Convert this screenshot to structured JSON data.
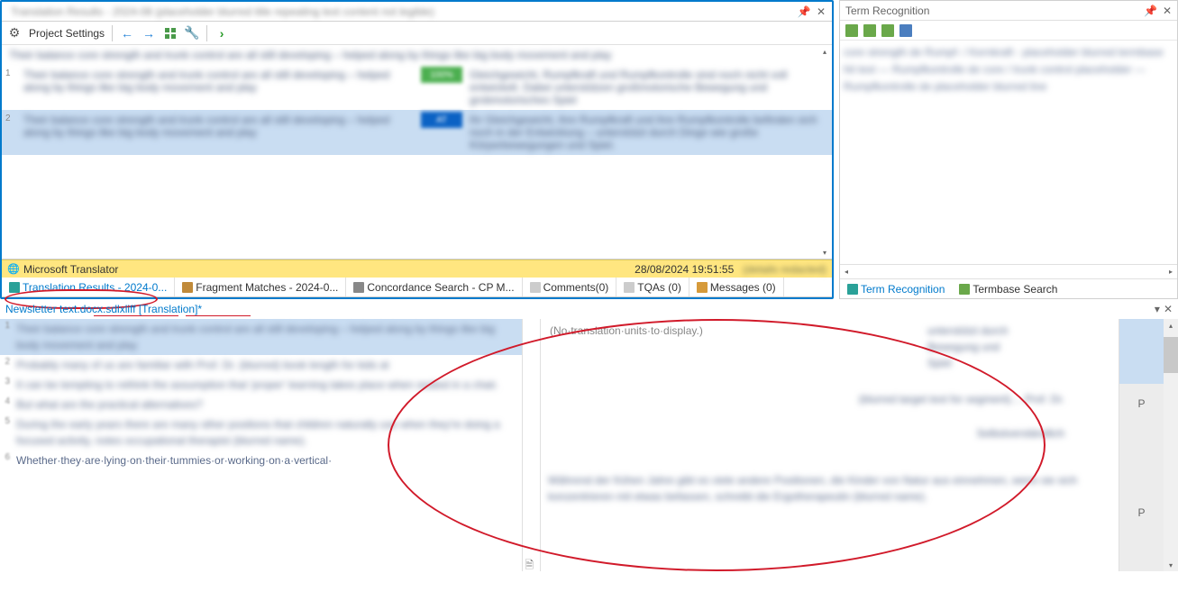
{
  "left_pane": {
    "header_blur": "Translation Results - 2024-08 (placeholder blurred title repeating text content not legible)",
    "toolbar": {
      "project_settings_label": "Project Settings"
    },
    "matches": {
      "top_line": "Their balance core strength and trunk control are all still developing – helped along by things like big body movement and play",
      "row1": {
        "num": "1",
        "src": "Their balance core strength and trunk control are all still developing – helped along by things like big body movement and play",
        "tgt": "Gleichgewicht, Rumpfkraft und Rumpfkontrolle sind noch nicht voll entwickelt. Dabei unterstützen großmotorische Bewegung und grobmotorisches Spiel"
      },
      "row2": {
        "num": "2",
        "src": "Their balance core strength and trunk control are all still developing – helped along by things like big body movement and play",
        "tgt": "Ihr Gleichgewicht, ihre Rumpfkraft und ihre Rumpfkontrolle befinden sich noch in der Entwicklung – unterstützt durch Dinge wie große Körperbewegungen und Spiel."
      }
    },
    "mt_bar": {
      "label": "Microsoft Translator",
      "timestamp": "28/08/2024 19:51:55",
      "extra_blur": "(details redacted)"
    },
    "tabs": {
      "results": "Translation Results - 2024-0...",
      "fragments": "Fragment Matches - 2024-0...",
      "concord": "Concordance Search - CP M...",
      "comments": "Comments(0)",
      "tqas": "TQAs (0)",
      "messages": "Messages (0)"
    }
  },
  "term_pane": {
    "title": "Term Recognition",
    "content_blur": "core strength   de   Rumpf- / Kernkraft - placeholder blurred termbase hit text — Rumpfkontrolle   de   core / trunk control placeholder — Rumpfkontrolle   de   placeholder blurred line",
    "tabs": {
      "term": "Term Recognition",
      "search": "Termbase Search"
    }
  },
  "doc": {
    "title": "Newsletter text.docx.sdlxliff [Translation]*",
    "empty_msg": "(No·translation·units·to·display.)",
    "segments": {
      "s1": {
        "n": "1",
        "t": "Their balance core strength and trunk control are all still developing – helped along by things like big body movement and play"
      },
      "s2": {
        "n": "2",
        "t": "Probably many of us are familiar with Prof. Dr. (blurred) book length for kids at"
      },
      "s3": {
        "n": "3",
        "t": "It can be tempting to rethink the assumption that 'proper' learning takes place when seated in a chair."
      },
      "s4": {
        "n": "4",
        "t": "But what are the practical alternatives?"
      },
      "s5": {
        "n": "5",
        "t": "During the early years there are many other positions that children naturally use when they're doing a focused activity, notes occupational therapist (blurred name)."
      },
      "s6": {
        "n": "6",
        "t": "Whether·they·are·lying·on·their·tummies·or·working·on·a·vertical·"
      }
    },
    "right_top": "unterstützt durch Bewegung und Spiel",
    "right_p2": "(blurred target text for segment)… Prof. Dr.",
    "right_p3": "Selbstverständlich",
    "right_bottom1": "Während der frühen Jahre gibt es viele andere Positionen, die Kinder von Natur aus einnehmen, wenn sie sich konzentrieren mit etwas befassen, schreibt die Ergotherapeutin (blurred name).",
    "p_labels": {
      "p1": "P",
      "p2": "P"
    }
  }
}
